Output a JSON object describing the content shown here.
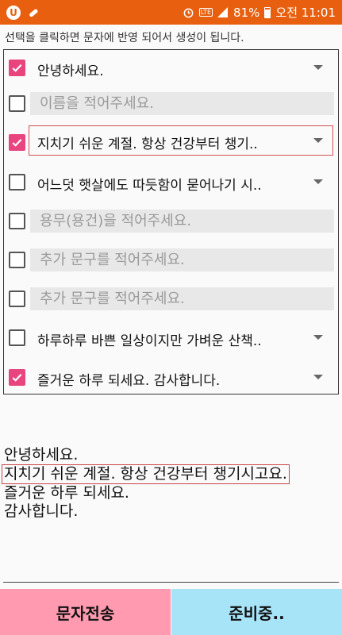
{
  "statusbar": {
    "app_icon": "U",
    "lte": "LTE",
    "battery": "81%",
    "time": "오전 11:01",
    "icons": [
      "app-icon",
      "pill-icon",
      "alarm-icon",
      "signal-icon",
      "battery-icon"
    ],
    "color": "#e8600f"
  },
  "hint": "선택을 클릭하면 문자에 반영 되어서 생성이 됩니다.",
  "rows": [
    {
      "type": "select",
      "checked": true,
      "text": "안녕하세요."
    },
    {
      "type": "input",
      "checked": false,
      "placeholder": "이름을 적어주세요."
    },
    {
      "type": "select",
      "checked": true,
      "text": "지치기 쉬운 계절. 항상 건강부터 챙기..",
      "selected": true
    },
    {
      "type": "select",
      "checked": false,
      "text": "어느덧 햇살에도 따듯함이 묻어나기 시.."
    },
    {
      "type": "input",
      "checked": false,
      "placeholder": "용무(용건)을 적어주세요."
    },
    {
      "type": "input",
      "checked": false,
      "placeholder": "추가 문구를 적어주세요."
    },
    {
      "type": "input",
      "checked": false,
      "placeholder": "추가 문구를 적어주세요."
    },
    {
      "type": "select",
      "checked": false,
      "text": "하루하루 바쁜 일상이지만 가벼운 산책.."
    },
    {
      "type": "select",
      "checked": true,
      "text": "즐거운 하루 되세요. 감사합니다."
    }
  ],
  "output": {
    "lines": [
      "안녕하세요.",
      "지치기 쉬운 계절. 항상 건강부터 챙기시고요.",
      "즐거운 하루 되세요.",
      "감사합니다."
    ]
  },
  "buttons": {
    "send_label": "문자전송",
    "ready_label": "준비중..",
    "send_color": "#ff9ab0",
    "ready_color": "#a8e4f8"
  },
  "accent": "#e8457e"
}
